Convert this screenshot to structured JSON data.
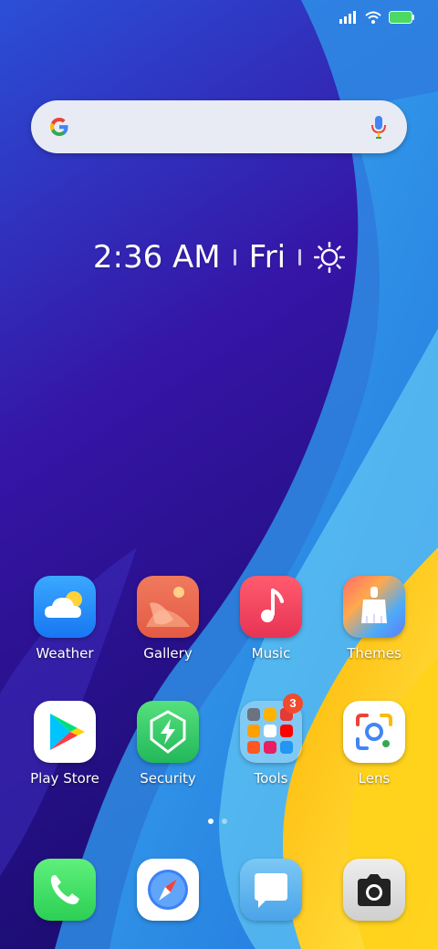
{
  "status_bar": {
    "signal_icon": "signal-bars-icon",
    "wifi_icon": "wifi-icon",
    "battery_icon": "battery-icon",
    "battery_color": "#4cd964"
  },
  "search_bar": {
    "placeholder": "",
    "logo_icon": "google-g-icon",
    "mic_icon": "microphone-icon"
  },
  "clock_widget": {
    "time": "2:36 AM",
    "day": "Fri",
    "weather_icon": "sun-icon"
  },
  "apps_row1": [
    {
      "label": "Weather",
      "icon": "weather-icon"
    },
    {
      "label": "Gallery",
      "icon": "gallery-icon"
    },
    {
      "label": "Music",
      "icon": "music-note-icon"
    },
    {
      "label": "Themes",
      "icon": "themes-brush-icon"
    }
  ],
  "apps_row2": [
    {
      "label": "Play Store",
      "icon": "play-store-icon"
    },
    {
      "label": "Security",
      "icon": "security-lightning-icon"
    },
    {
      "label": "Tools",
      "icon": "tools-folder-icon",
      "badge": "3"
    },
    {
      "label": "Lens",
      "icon": "lens-icon"
    }
  ],
  "page_indicator": {
    "pages": 2,
    "active_index": 0
  },
  "dock": [
    {
      "icon": "phone-icon"
    },
    {
      "icon": "browser-compass-icon"
    },
    {
      "icon": "messages-icon"
    },
    {
      "icon": "camera-icon"
    }
  ]
}
